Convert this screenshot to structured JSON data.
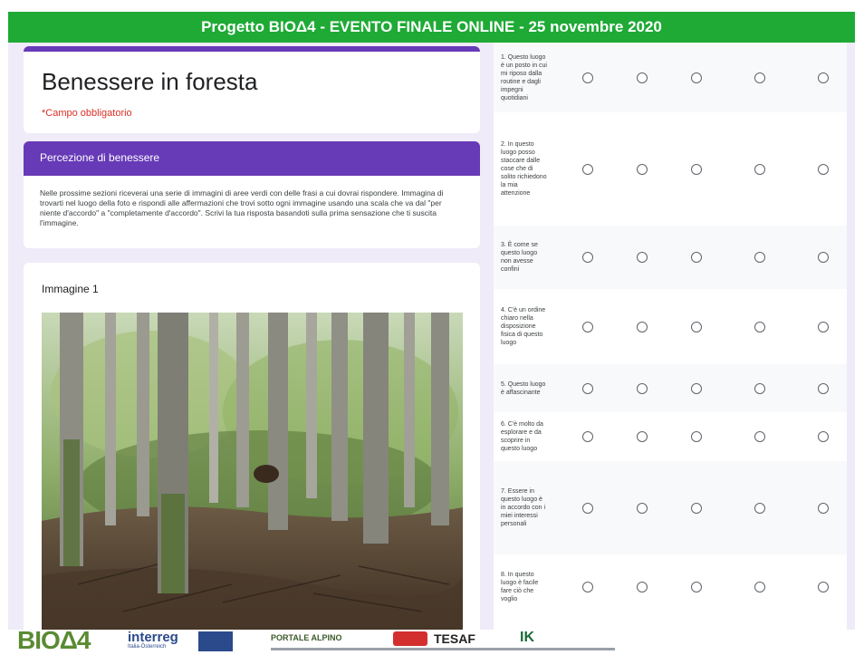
{
  "banner": {
    "text": "Progetto BIOΔ4  - EVENTO FINALE ONLINE  - 25 novembre 2020"
  },
  "form": {
    "title": "Benessere in foresta",
    "required_note": "*Campo obbligatorio"
  },
  "section": {
    "header": "Percezione di benessere",
    "description": "Nelle prossime sezioni riceverai una serie di immagini di aree verdi con delle frasi a cui dovrai rispondere. Immagina di trovarti nel luogo della foto e rispondi alle affermazioni che trovi sotto ogni immagine usando una scala che va dal \"per niente d'accordo\" a \"completamente d'accordo\". Scrivi la tua risposta basandoti sulla prima sensazione che ti suscita l'immagine."
  },
  "image_card": {
    "label": "Immagine 1"
  },
  "grid": {
    "rows": [
      {
        "label": "1. Questo luogo è un posto in cui mi riposo dalla routine e dagli impegni quotidiani"
      },
      {
        "label": "2. In questo luogo posso staccare dalle cose che di solito richiedono la mia attenzione"
      },
      {
        "label": "3. È come se questo luogo non avesse confini"
      },
      {
        "label": "4. C'è un ordine chiaro nella disposizione fisica di questo luogo"
      },
      {
        "label": "5. Questo luogo è affascinante"
      },
      {
        "label": "6. C'è molto da esplorare e da scoprire in questo luogo"
      },
      {
        "label": "7. Essere in questo luogo è in accordo con i miei interessi personali"
      },
      {
        "label": "8. In questo luogo è facile fare ciò che voglio"
      }
    ]
  },
  "logos": {
    "bio": "BIOΔ4",
    "interreg": "interreg",
    "interreg_sub": "Italia-Österreich",
    "partners": "PORTALE ALPINO",
    "tesaf": "TESAF",
    "ik": "IK"
  }
}
